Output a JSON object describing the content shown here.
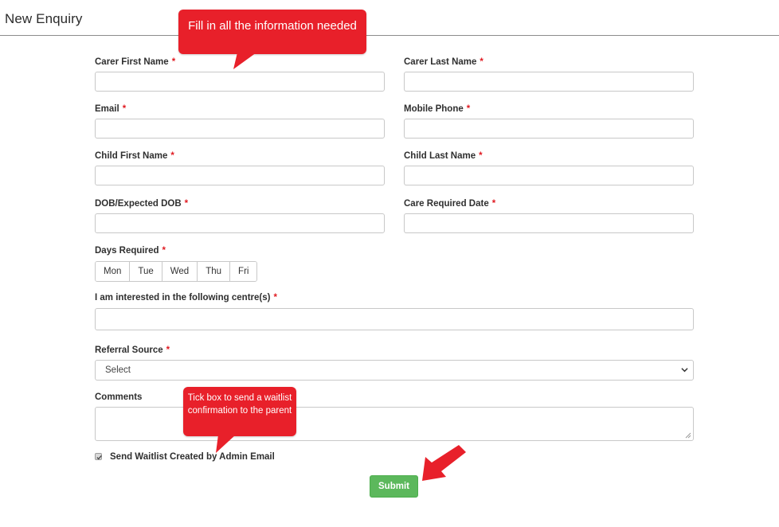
{
  "page": {
    "title": "New Enquiry"
  },
  "callouts": {
    "fill_info": "Fill in all the information needed",
    "tick_box": "Tick box to send a waitlist confirmation to the parent"
  },
  "form": {
    "required_marker": "*",
    "carer_first_name": {
      "label": "Carer First Name",
      "value": ""
    },
    "carer_last_name": {
      "label": "Carer Last Name",
      "value": ""
    },
    "email": {
      "label": "Email",
      "value": ""
    },
    "mobile_phone": {
      "label": "Mobile Phone",
      "value": ""
    },
    "child_first_name": {
      "label": "Child First Name",
      "value": ""
    },
    "child_last_name": {
      "label": "Child Last Name",
      "value": ""
    },
    "dob": {
      "label": "DOB/Expected DOB",
      "value": ""
    },
    "care_required_date": {
      "label": "Care Required Date",
      "value": ""
    },
    "days_required": {
      "label": "Days Required",
      "days": [
        "Mon",
        "Tue",
        "Wed",
        "Thu",
        "Fri"
      ]
    },
    "centres": {
      "label": "I am interested in the following centre(s)",
      "value": ""
    },
    "referral_source": {
      "label": "Referral Source",
      "selected": "Select"
    },
    "comments": {
      "label": "Comments",
      "value": ""
    },
    "send_waitlist": {
      "label": "Send Waitlist Created by Admin Email",
      "checked": true
    },
    "submit_label": "Submit"
  },
  "colors": {
    "callout": "#e8202a",
    "submit": "#5cb85c",
    "required": "#e01b22"
  }
}
